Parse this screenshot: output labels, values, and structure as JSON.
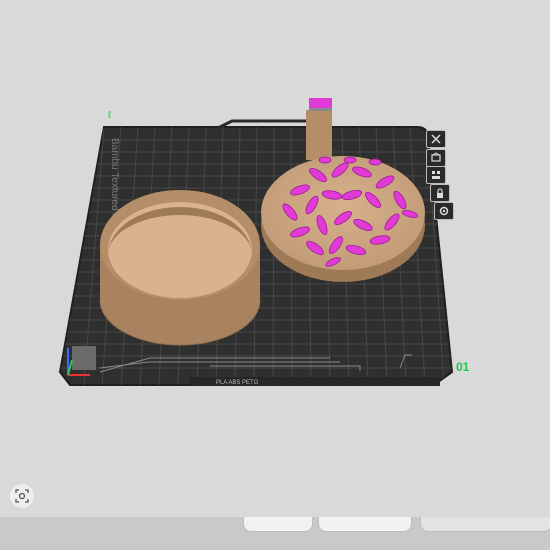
{
  "plate": {
    "texture_label": "Bambu Textured PEI",
    "filament_label": "PLA ABS PETG",
    "plate_number": "01"
  },
  "icons": {
    "close": "close-icon",
    "auto_orient": "auto-orient-icon",
    "arrange": "arrange-icon",
    "lock": "lock-icon",
    "settings": "settings-icon",
    "camera": "camera-view-icon"
  },
  "colors": {
    "background": "#d9d9d9",
    "plate": "#2f2f2f",
    "grid": "#4a4a4a",
    "model_tan": "#c19a74",
    "model_magenta": "#e13ad6",
    "plate_number": "#1ec84e"
  }
}
